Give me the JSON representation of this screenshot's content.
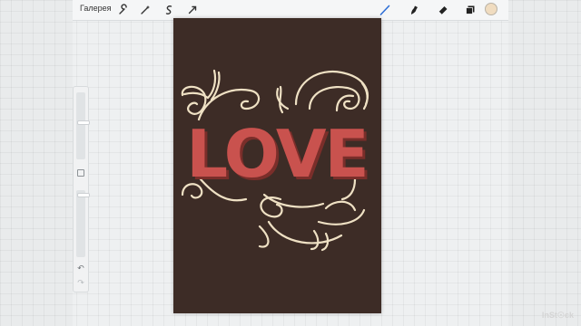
{
  "toolbar": {
    "gallery_label": "Галерея",
    "left_tools": [
      "wrench-icon",
      "magic-wand-icon",
      "selection-icon",
      "transform-arrow-icon"
    ],
    "right_tools": [
      "brush-icon",
      "smudge-icon",
      "eraser-icon",
      "layers-icon"
    ],
    "active_tool": "brush-icon",
    "accent_color": "#2f6fd6",
    "current_color": "#f0dcc0"
  },
  "sidebar": {
    "brush_size": 0.55,
    "brush_opacity": 0.95
  },
  "artwork": {
    "text": "LOVE",
    "background_color": "#3d2c26",
    "letter_color": "#c9524e",
    "letter_shadow_color": "#7a2e2a",
    "swirl_color": "#efe1c4"
  },
  "watermark": "InSt☉ck"
}
